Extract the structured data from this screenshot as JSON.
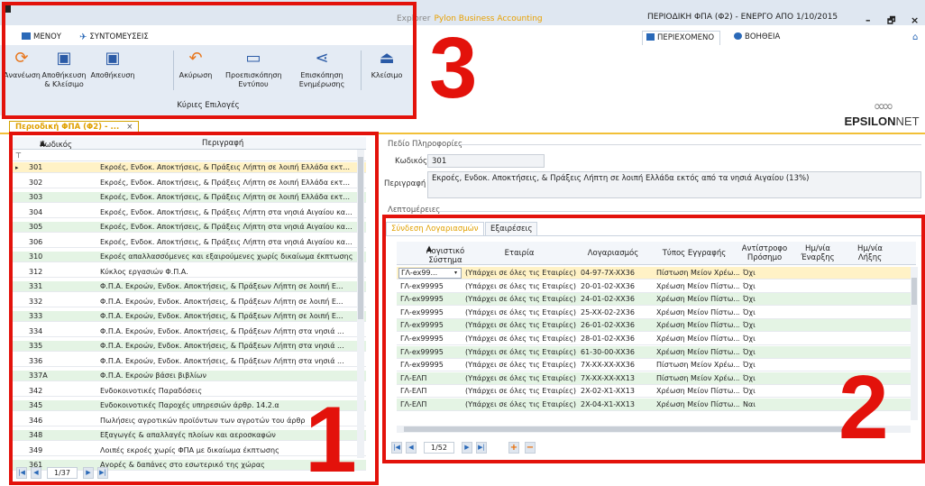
{
  "window": {
    "caption": "Explorer",
    "brand": "Pylon Business Accounting",
    "title": "ΠΕΡΙΟΔΙΚΗ ΦΠΑ (Φ2) - ΕΝΕΡΓΟ ΑΠΟ 1/10/2015",
    "minimize": "–",
    "restore": "🗗",
    "close": "×"
  },
  "ribbon_tabs": [
    {
      "label": "ΜΕΝΟΥ",
      "icon": "menu-icon"
    },
    {
      "label": "ΣΥΝΤΟΜΕΥΣΕΙΣ",
      "icon": "shortcut-pin-icon"
    }
  ],
  "right_tabs": [
    {
      "label": "ΠΕΡΙΕΧΟΜΕΝΟ",
      "icon": "content-icon"
    },
    {
      "label": "ΒΟΗΘΕΙΑ",
      "icon": "help-icon"
    }
  ],
  "ribbon": {
    "group_label": "Κύριες Επιλογές",
    "buttons": [
      {
        "label": "Ανανέωση",
        "icon": "refresh-icon",
        "color": "#e8761c"
      },
      {
        "label": "Αποθήκευση & Κλείσιμο",
        "icon": "save-close-icon",
        "color": "#2a5aa6"
      },
      {
        "label": "Αποθήκευση",
        "icon": "save-icon",
        "color": "#2a5aa6"
      },
      {
        "label": "Ακύρωση",
        "icon": "undo-icon",
        "color": "#e8761c"
      },
      {
        "label": "Προεπισκόπηση Εντύπου",
        "icon": "print-preview-icon",
        "color": "#2a5aa6"
      },
      {
        "label": "Επισκόπηση Ενημέρωσης",
        "icon": "share-icon",
        "color": "#2a5aa6"
      },
      {
        "label": "Κλείσιμο",
        "icon": "eject-icon",
        "color": "#2a5aa6"
      }
    ]
  },
  "annotations": [
    "1",
    "2",
    "3"
  ],
  "logo": {
    "part1": "EPSILON",
    "part2": "NET"
  },
  "doc_tab": {
    "label": "Περιοδική ΦΠΑ (Φ2) - ...",
    "close": "×"
  },
  "left_grid": {
    "columns": [
      "Κωδικός",
      "Περιγραφή"
    ],
    "rows": [
      {
        "code": "301",
        "desc": "Εκροές, Ενδοκ. Αποκτήσεις, & Πράξεις Λήπτη σε λοιπή Ελλάδα εκτ..."
      },
      {
        "code": "302",
        "desc": "Εκροές, Ενδοκ. Αποκτήσεις, & Πράξεις Λήπτη σε λοιπή Ελλάδα εκτ..."
      },
      {
        "code": "303",
        "desc": "Εκροές, Ενδοκ. Αποκτήσεις, & Πράξεις Λήπτη σε λοιπή Ελλάδα εκτ..."
      },
      {
        "code": "304",
        "desc": "Εκροές, Ενδοκ. Αποκτήσεις, & Πράξεις Λήπτη στα νησιά Αιγαίου κα..."
      },
      {
        "code": "305",
        "desc": "Εκροές, Ενδοκ. Αποκτήσεις, & Πράξεις Λήπτη στα νησιά Αιγαίου κα..."
      },
      {
        "code": "306",
        "desc": "Εκροές, Ενδοκ. Αποκτήσεις, & Πράξεις Λήπτη στα νησιά Αιγαίου κα..."
      },
      {
        "code": "310",
        "desc": "Εκροές απαλλασσόμενες και εξαιρούμενες χωρίς δικαίωμα έκπτωσης"
      },
      {
        "code": "312",
        "desc": "Κύκλος εργασιών Φ.Π.Α."
      },
      {
        "code": "331",
        "desc": "Φ.Π.Α. Εκροών, Ενδοκ. Αποκτήσεις, & Πράξεων Λήπτη σε λοιπή Ε..."
      },
      {
        "code": "332",
        "desc": "Φ.Π.Α. Εκροών, Ενδοκ. Αποκτήσεις, & Πράξεων Λήπτη σε λοιπή Ε..."
      },
      {
        "code": "333",
        "desc": "Φ.Π.Α. Εκροών, Ενδοκ. Αποκτήσεις, & Πράξεων Λήπτη σε λοιπή Ε..."
      },
      {
        "code": "334",
        "desc": "Φ.Π.Α. Εκροών, Ενδοκ. Αποκτήσεις, & Πράξεων Λήπτη στα νησιά ..."
      },
      {
        "code": "335",
        "desc": "Φ.Π.Α. Εκροών, Ενδοκ. Αποκτήσεις, & Πράξεων Λήπτη στα νησιά ..."
      },
      {
        "code": "336",
        "desc": "Φ.Π.Α. Εκροών, Ενδοκ. Αποκτήσεις, & Πράξεων Λήπτη στα νησιά ..."
      },
      {
        "code": "337Α",
        "desc": "Φ.Π.Α. Εκροών βάσει βιβλίων"
      },
      {
        "code": "342",
        "desc": "Ενδοκοινοτικές Παραδόσεις"
      },
      {
        "code": "345",
        "desc": "Ενδοκοινοτικές Παροχές υπηρεσιών άρθρ. 14.2.α"
      },
      {
        "code": "346",
        "desc": "Πωλήσεις αγροτικών προϊόντων των αγροτών του άρθρ"
      },
      {
        "code": "348",
        "desc": "Εξαγωγές & απαλλαγές πλοίων και αεροσκαφών"
      },
      {
        "code": "349",
        "desc": "Λοιπές εκροές χωρίς ΦΠΑ με δικαίωμα έκπτωσης"
      },
      {
        "code": "361",
        "desc": "Αγορές & δαπάνες στο εσωτερικό της χώρας"
      }
    ],
    "page": "1/37"
  },
  "info": {
    "section_title": "Πεδίο Πληροφορίες",
    "code_label": "Κωδικός",
    "code_value": "301",
    "desc_label": "Περιγραφή",
    "desc_value": "Εκροές, Ενδοκ. Αποκτήσεις, & Πράξεις Λήπτη σε λοιπή Ελλάδα εκτός από τα νησιά Αιγαίου (13%)",
    "details_title": "Λεπτομέρειες"
  },
  "subtabs": [
    "Σύνδεση Λογαριασμών",
    "Εξαιρέσεις"
  ],
  "right_grid": {
    "columns": [
      "Λογιστικό Σύστημα",
      "Εταιρία",
      "Λογαριασμός",
      "Τύπος Εγγραφής",
      "Αντίστροφο Πρόσημο",
      "Ημ/νία Έναρξης",
      "Ημ/νία Λήξης"
    ],
    "rows": [
      {
        "system": "ΓΛ-ex99...",
        "company": "(Υπάρχει σε όλες τις Εταιρίες)",
        "account": "04-97-7X-XX36",
        "type": "Πίστωση Μείον Χρέω...",
        "reverse": "Όχι"
      },
      {
        "system": "ΓΛ-ex99995",
        "company": "(Υπάρχει σε όλες τις Εταιρίες)",
        "account": "20-01-02-XX36",
        "type": "Χρέωση Μείον Πίστω...",
        "reverse": "Όχι"
      },
      {
        "system": "ΓΛ-ex99995",
        "company": "(Υπάρχει σε όλες τις Εταιρίες)",
        "account": "24-01-02-XX36",
        "type": "Χρέωση Μείον Πίστω...",
        "reverse": "Όχι"
      },
      {
        "system": "ΓΛ-ex99995",
        "company": "(Υπάρχει σε όλες τις Εταιρίες)",
        "account": "25-XX-02-2X36",
        "type": "Χρέωση Μείον Πίστω...",
        "reverse": "Όχι"
      },
      {
        "system": "ΓΛ-ex99995",
        "company": "(Υπάρχει σε όλες τις Εταιρίες)",
        "account": "26-01-02-XX36",
        "type": "Χρέωση Μείον Πίστω...",
        "reverse": "Όχι"
      },
      {
        "system": "ΓΛ-ex99995",
        "company": "(Υπάρχει σε όλες τις Εταιρίες)",
        "account": "28-01-02-XX36",
        "type": "Χρέωση Μείον Πίστω...",
        "reverse": "Όχι"
      },
      {
        "system": "ΓΛ-ex99995",
        "company": "(Υπάρχει σε όλες τις Εταιρίες)",
        "account": "61-30-00-XX36",
        "type": "Χρέωση Μείον Πίστω...",
        "reverse": "Όχι"
      },
      {
        "system": "ΓΛ-ex99995",
        "company": "(Υπάρχει σε όλες τις Εταιρίες)",
        "account": "7X-XX-XX-XX36",
        "type": "Πίστωση Μείον Χρέω...",
        "reverse": "Όχι"
      },
      {
        "system": "ΓΛ-ΕΛΠ",
        "company": "(Υπάρχει σε όλες τις Εταιρίες)",
        "account": "7X-XX-XX-XX13",
        "type": "Πίστωση Μείον Χρέω...",
        "reverse": "Όχι"
      },
      {
        "system": "ΓΛ-ΕΛΠ",
        "company": "(Υπάρχει σε όλες τις Εταιρίες)",
        "account": "2X-02-X1-XX13",
        "type": "Χρέωση Μείον Πίστω...",
        "reverse": "Όχι"
      },
      {
        "system": "ΓΛ-ΕΛΠ",
        "company": "(Υπάρχει σε όλες τις Εταιρίες)",
        "account": "2X-04-X1-XX13",
        "type": "Χρέωση Μείον Πίστω...",
        "reverse": "Ναι"
      }
    ],
    "page": "1/52"
  },
  "colors": {
    "accent": "#2a69b8",
    "orange": "#e8761c",
    "annotation_red": "#e3120b",
    "selected_row": "#fff2c6",
    "alt_row": "#e4f4e4"
  }
}
